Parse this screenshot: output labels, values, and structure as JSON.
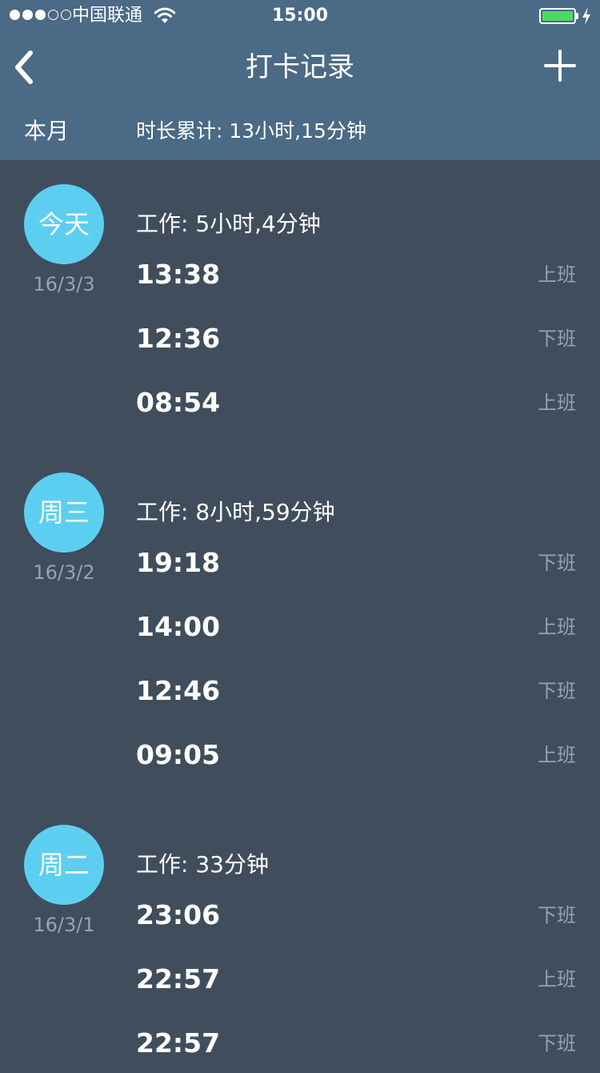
{
  "status_bar": {
    "carrier": "中国联通",
    "time": "15:00",
    "signal_bars": 5,
    "signal_filled": 3,
    "battery_level": 1.0
  },
  "nav": {
    "title": "打卡记录",
    "back_icon": "chevron-left-icon",
    "add_icon": "plus-icon"
  },
  "summary": {
    "period": "本月",
    "total": "时长累计: 13小时,15分钟"
  },
  "colors": {
    "header_bg": "#4b6a85",
    "page_bg": "#404d5c",
    "circle_bg": "#5ccff0",
    "secondary_text": "#98a3b0",
    "battery_green": "#4cd964"
  },
  "days": [
    {
      "label": "今天",
      "date": "16/3/3",
      "work": "工作: 5小时,4分钟",
      "entries": [
        {
          "time": "13:38",
          "type": "上班"
        },
        {
          "time": "12:36",
          "type": "下班"
        },
        {
          "time": "08:54",
          "type": "上班"
        }
      ]
    },
    {
      "label": "周三",
      "date": "16/3/2",
      "work": "工作: 8小时,59分钟",
      "entries": [
        {
          "time": "19:18",
          "type": "下班"
        },
        {
          "time": "14:00",
          "type": "上班"
        },
        {
          "time": "12:46",
          "type": "下班"
        },
        {
          "time": "09:05",
          "type": "上班"
        }
      ]
    },
    {
      "label": "周二",
      "date": "16/3/1",
      "work": "工作: 33分钟",
      "entries": [
        {
          "time": "23:06",
          "type": "下班"
        },
        {
          "time": "22:57",
          "type": "上班"
        },
        {
          "time": "22:57",
          "type": "下班"
        }
      ]
    }
  ]
}
